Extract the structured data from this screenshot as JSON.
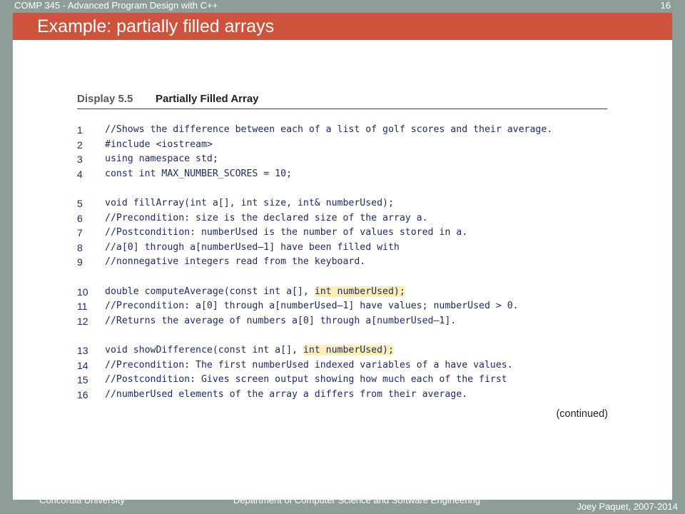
{
  "header": {
    "course": "COMP 345 - Advanced Program Design with C++",
    "page_number": "16"
  },
  "slide": {
    "title": "Example: partially filled arrays"
  },
  "display": {
    "number": "Display 5.5",
    "title": "Partially Filled Array",
    "lines": [
      {
        "n": "1",
        "pre": "//Shows the difference between each of a list of golf scores and their average.",
        "hl": "",
        "post": ""
      },
      {
        "n": "2",
        "pre": "#include <iostream>",
        "hl": "",
        "post": ""
      },
      {
        "n": "3",
        "pre": "using namespace std;",
        "hl": "",
        "post": ""
      },
      {
        "n": "4",
        "pre": "const int MAX_NUMBER_SCORES = 10;",
        "hl": "",
        "post": ""
      },
      {
        "n": "",
        "pre": "",
        "hl": "",
        "post": ""
      },
      {
        "n": "5",
        "pre": "void fillArray(int a[], int size, int& numberUsed);",
        "hl": "",
        "post": ""
      },
      {
        "n": "6",
        "pre": "//Precondition: size is the declared size of the array a.",
        "hl": "",
        "post": ""
      },
      {
        "n": "7",
        "pre": "//Postcondition: numberUsed is the number of values stored in a.",
        "hl": "",
        "post": ""
      },
      {
        "n": "8",
        "pre": "//a[0] through a[numberUsed–1] have been filled with",
        "hl": "",
        "post": ""
      },
      {
        "n": "9",
        "pre": "//nonnegative integers read from the keyboard.",
        "hl": "",
        "post": ""
      },
      {
        "n": "",
        "pre": "",
        "hl": "",
        "post": ""
      },
      {
        "n": "10",
        "pre": "double computeAverage(const int a[], ",
        "hl": "int numberUsed);",
        "post": ""
      },
      {
        "n": "11",
        "pre": "//Precondition: a[0] through a[numberUsed–1] have values; numberUsed > 0.",
        "hl": "",
        "post": ""
      },
      {
        "n": "12",
        "pre": "//Returns the average of numbers a[0] through a[numberUsed–1].",
        "hl": "",
        "post": ""
      },
      {
        "n": "",
        "pre": "",
        "hl": "",
        "post": ""
      },
      {
        "n": "13",
        "pre": "void showDifference(const int a[], ",
        "hl": "int numberUsed);",
        "post": ""
      },
      {
        "n": "14",
        "pre": "//Precondition: The first numberUsed indexed variables of a have values.",
        "hl": "",
        "post": ""
      },
      {
        "n": "15",
        "pre": "//Postcondition: Gives screen output showing how much each of the first",
        "hl": "",
        "post": ""
      },
      {
        "n": "16",
        "pre": "//numberUsed elements of the array a differs from their average.",
        "hl": "",
        "post": ""
      }
    ],
    "continued": "(continued)"
  },
  "footer": {
    "left": "Concordia University",
    "middle": "Department of Computer Science and Software Engineering",
    "right": "Joey Paquet, 2007-2014"
  }
}
